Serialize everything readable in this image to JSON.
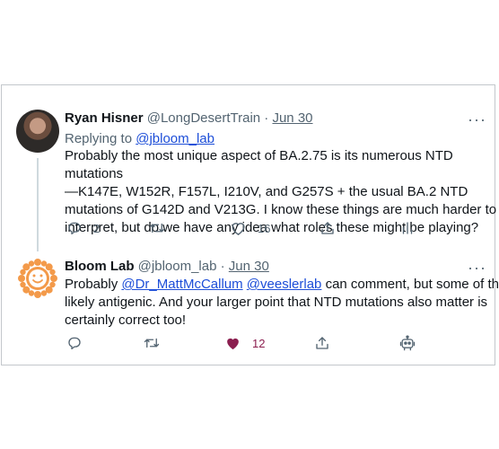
{
  "tweet1": {
    "name": "Ryan Hisner",
    "handle": "@LongDesertTrain",
    "separator": "·",
    "date": "Jun 30",
    "more": "···",
    "replying_prefix": "Replying to",
    "replying_handle": "@jbloom_lab",
    "lines": [
      "Probably the most unique aspect of BA.2.75 is its numerous NTD mutations",
      "—K147E, W152R, F157L, I210V, and G257S + the usual BA.2 NTD",
      "mutations of G142D and V213G. I know these things are much harder to",
      "interpret, but do we have any idea what roles these might be playing?"
    ],
    "reply_count": "2",
    "like_count": "16",
    "icons": [
      "reply-icon",
      "retweet-icon",
      "heart-icon",
      "share-icon",
      "analytics-icon"
    ]
  },
  "tweet2": {
    "name": "Bloom Lab",
    "handle": "@jbloom_lab",
    "separator": "·",
    "date": "Jun 30",
    "more": "···",
    "line1_prefix": "Probably ",
    "mention1": "@Dr_MattMcCallum",
    "mention2": "@veeslerlab",
    "line1_suffix": " can comment, but some of these",
    "line2": "likely antigenic. And your larger point that NTD mutations also matter is",
    "line3": "certainly correct too!",
    "like_count": "12",
    "icons": [
      "reply-icon",
      "retweet-icon",
      "heart-filled-icon",
      "share-icon",
      "bot-icon"
    ]
  },
  "colors": {
    "like_active": "#8b1e4f",
    "link": "#1d4ed8",
    "muted": "#536471",
    "sun": "#f39a4a"
  }
}
